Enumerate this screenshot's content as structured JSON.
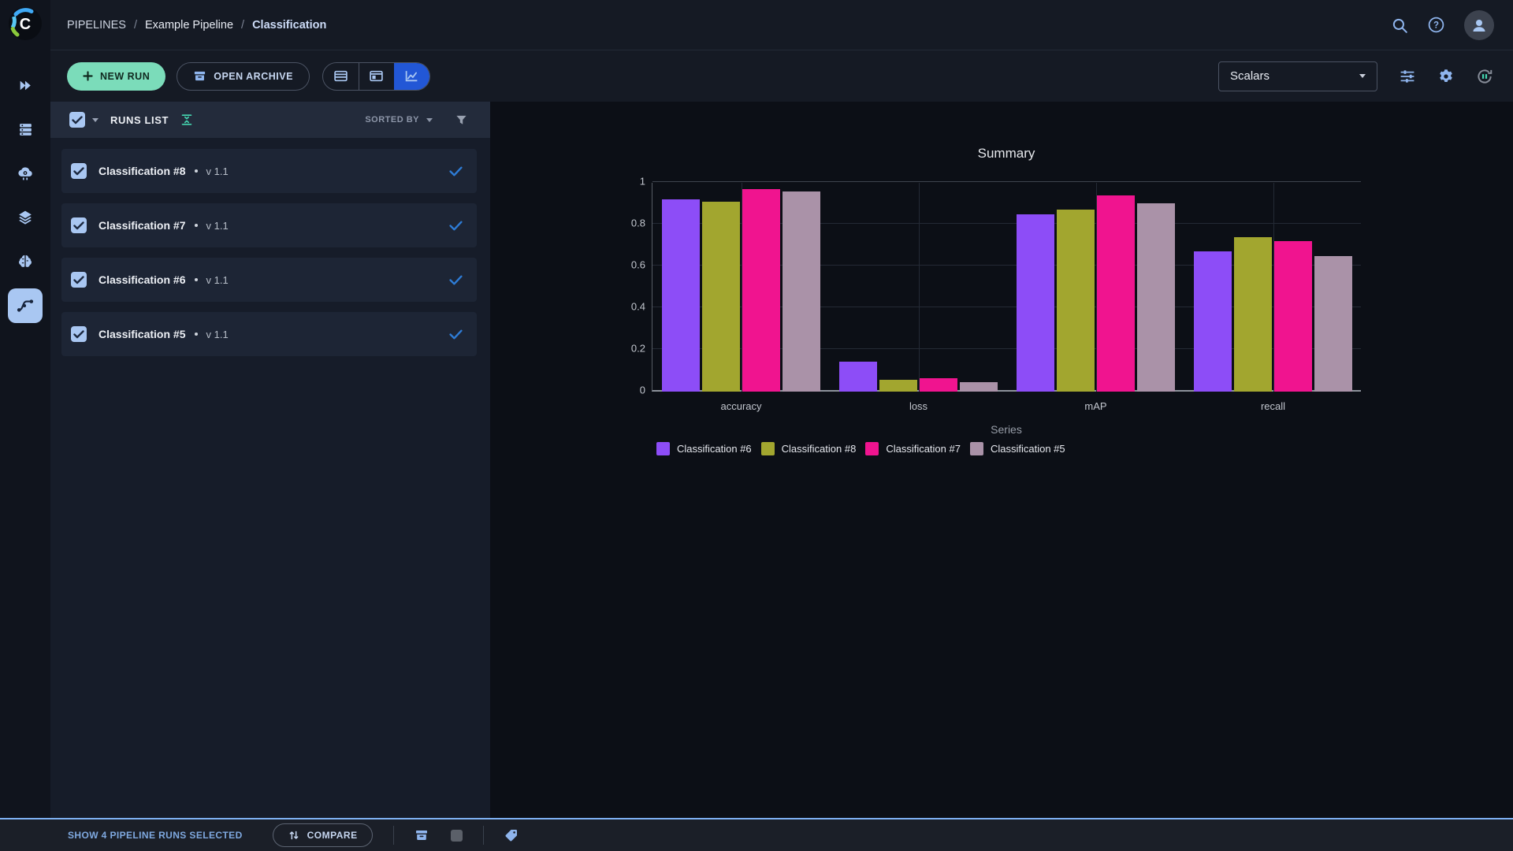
{
  "nav": {
    "breadcrumb": [
      "PIPELINES",
      "Example Pipeline",
      "Classification"
    ],
    "separator": "/"
  },
  "sidebar": {
    "items": [
      "projects",
      "workers-queues",
      "applications",
      "datasets",
      "models",
      "pipelines"
    ],
    "active": "pipelines"
  },
  "toolbar": {
    "new_run_label": "NEW RUN",
    "open_archive_label": "OPEN ARCHIVE",
    "view_toggles": [
      "table-view",
      "split-view",
      "chart-view"
    ],
    "active_view": "chart-view",
    "metric_select_value": "Scalars"
  },
  "runs_panel": {
    "title": "RUNS LIST",
    "sorted_by_label": "SORTED BY",
    "runs": [
      {
        "name": "Classification #8",
        "version": "v 1.1",
        "checked": true
      },
      {
        "name": "Classification #7",
        "version": "v 1.1",
        "checked": true
      },
      {
        "name": "Classification #6",
        "version": "v 1.1",
        "checked": true
      },
      {
        "name": "Classification #5",
        "version": "v 1.1",
        "checked": true
      }
    ]
  },
  "footer": {
    "selected_text": "SHOW 4 PIPELINE RUNS SELECTED",
    "compare_label": "COMPARE"
  },
  "chart_data": {
    "type": "bar",
    "title": "Summary",
    "legend_title": "Series",
    "legend_position": "bottom",
    "grid": true,
    "categories": [
      "accuracy",
      "loss",
      "mAP",
      "recall"
    ],
    "series": [
      {
        "name": "Classification #6",
        "color": "#8d4df7",
        "values": [
          0.92,
          0.145,
          0.85,
          0.67
        ]
      },
      {
        "name": "Classification #8",
        "color": "#a2a62f",
        "values": [
          0.91,
          0.057,
          0.87,
          0.74
        ]
      },
      {
        "name": "Classification #7",
        "color": "#f0148f",
        "values": [
          0.97,
          0.066,
          0.94,
          0.72
        ]
      },
      {
        "name": "Classification #5",
        "color": "#aa92a8",
        "values": [
          0.96,
          0.044,
          0.9,
          0.65
        ]
      }
    ],
    "ylim": [
      0,
      1
    ],
    "yticks": [
      0,
      0.2,
      0.4,
      0.6,
      0.8,
      1
    ]
  },
  "colors": {
    "accent_blue": "#8fb5ee",
    "selected_blue": "#2257d6",
    "new_run_green": "#7bdcba",
    "footer_accent": "#7fb2f4",
    "check_blue": "#2e7cd6",
    "green_icon": "#45d6b1"
  }
}
